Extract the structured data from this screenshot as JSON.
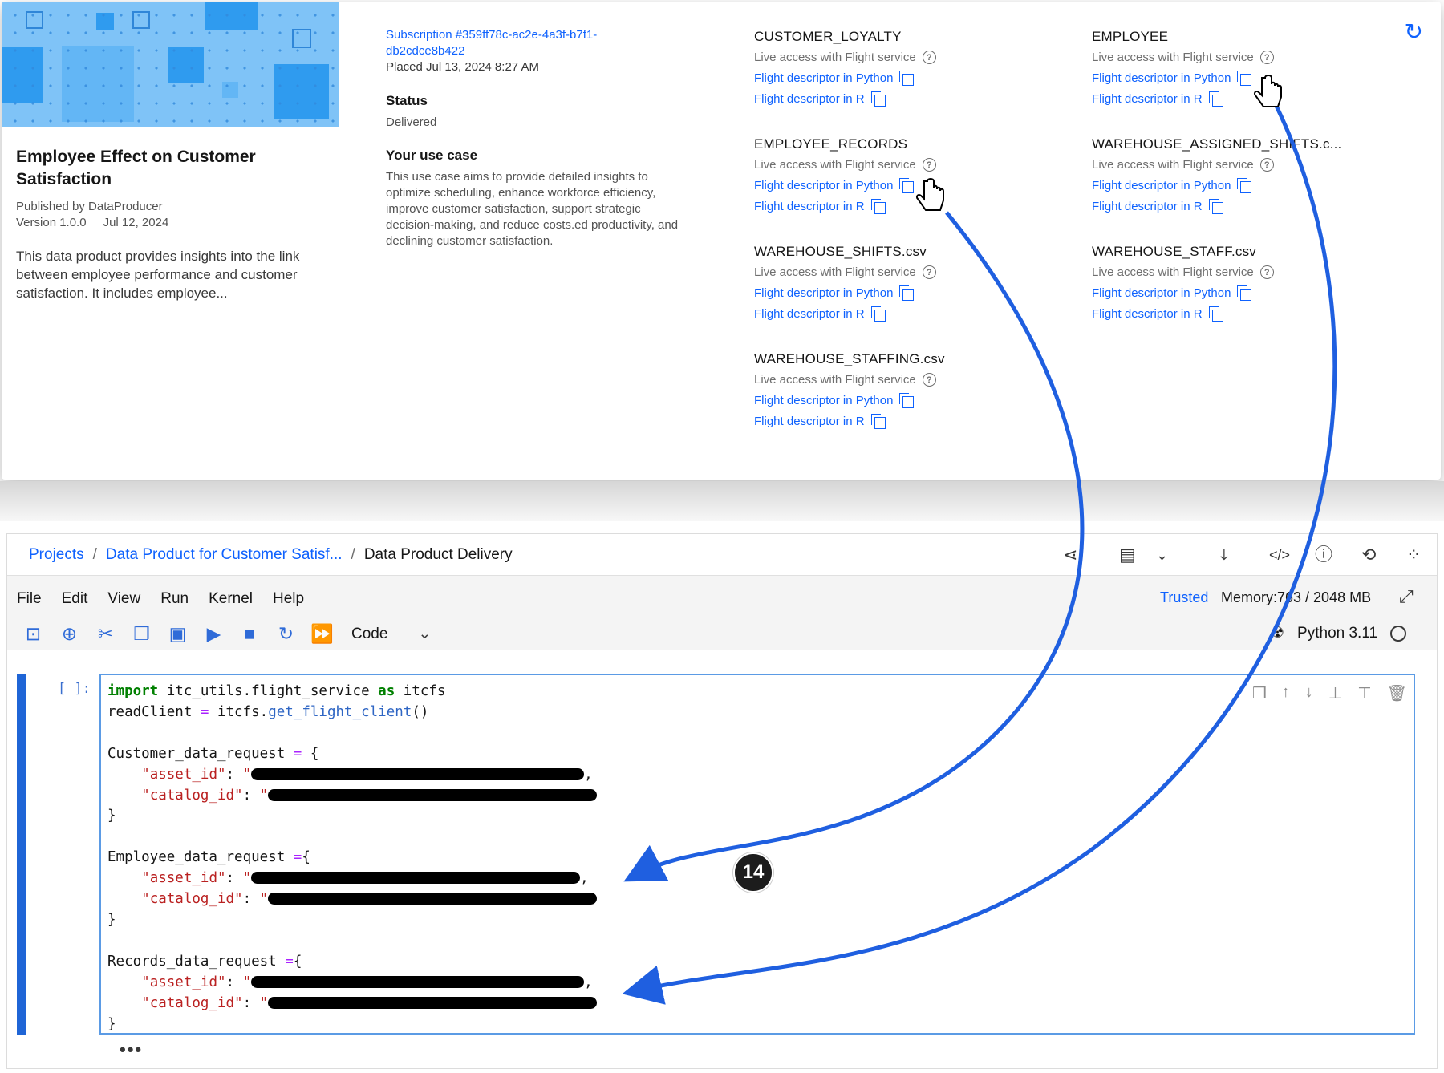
{
  "product": {
    "title": "Employee Effect on Customer Satisfaction",
    "published_by": "Published by DataProducer",
    "version": "Version 1.0.0",
    "version_date": "Jul 12, 2024",
    "description": "This data product provides insights into the link between employee performance and customer satisfaction. It includes employee..."
  },
  "order": {
    "subscription": "Subscription #359ff78c-ac2e-4a3f-b7f1-db2cdce8b422",
    "placed": "Placed Jul 13, 2024 8:27 AM",
    "status_label": "Status",
    "status_value": "Delivered",
    "usecase_label": "Your use case",
    "usecase_text": "This use case aims to provide detailed insights to optimize scheduling, enhance workforce efficiency, improve customer satisfaction, support strategic decision-making, and reduce costs.ed productivity, and declining customer satisfaction."
  },
  "assets": [
    {
      "name": "CUSTOMER_LOYALTY"
    },
    {
      "name": "EMPLOYEE"
    },
    {
      "name": "EMPLOYEE_RECORDS"
    },
    {
      "name": "WAREHOUSE_ASSIGNED_SHIFTS.c..."
    },
    {
      "name": "WAREHOUSE_SHIFTS.csv"
    },
    {
      "name": "WAREHOUSE_STAFF.csv"
    },
    {
      "name": "WAREHOUSE_STAFFING.csv"
    }
  ],
  "asset_labels": {
    "live": "Live access with Flight service",
    "python": "Flight descriptor in Python",
    "r": "Flight descriptor in R"
  },
  "notebook": {
    "breadcrumb": {
      "projects": "Projects",
      "project": "Data Product for Customer Satisf...",
      "current": "Data Product Delivery"
    },
    "menu": [
      "File",
      "Edit",
      "View",
      "Run",
      "Kernel",
      "Help"
    ],
    "trusted": "Trusted",
    "memory": "Memory:763 / 2048 MB",
    "cell_type": "Code",
    "kernel": "Python 3.11",
    "prompt": "[ ]:",
    "code": {
      "l1_kw": "import",
      "l1_mod": " itc_utils.flight_service ",
      "l1_as": "as",
      "l1_alias": " itcfs",
      "l2_var": "readClient ",
      "l2_eq": "=",
      "l2_obj": " itcfs.",
      "l2_fn": "get_flight_client",
      "l2_end": "()",
      "customer_var": "Customer_data_request ",
      "employee_var": "Employee_data_request ",
      "records_var": "Records_data_request ",
      "asset_key": "\"asset_id\"",
      "catalog_key": "\"catalog_id\""
    }
  },
  "step_badge": "14",
  "colors": {
    "link": "#0f62fe",
    "arrow": "#1f5fe0",
    "cell_bar": "#1f65d6",
    "thumb_bg": "#7fc3f7"
  }
}
